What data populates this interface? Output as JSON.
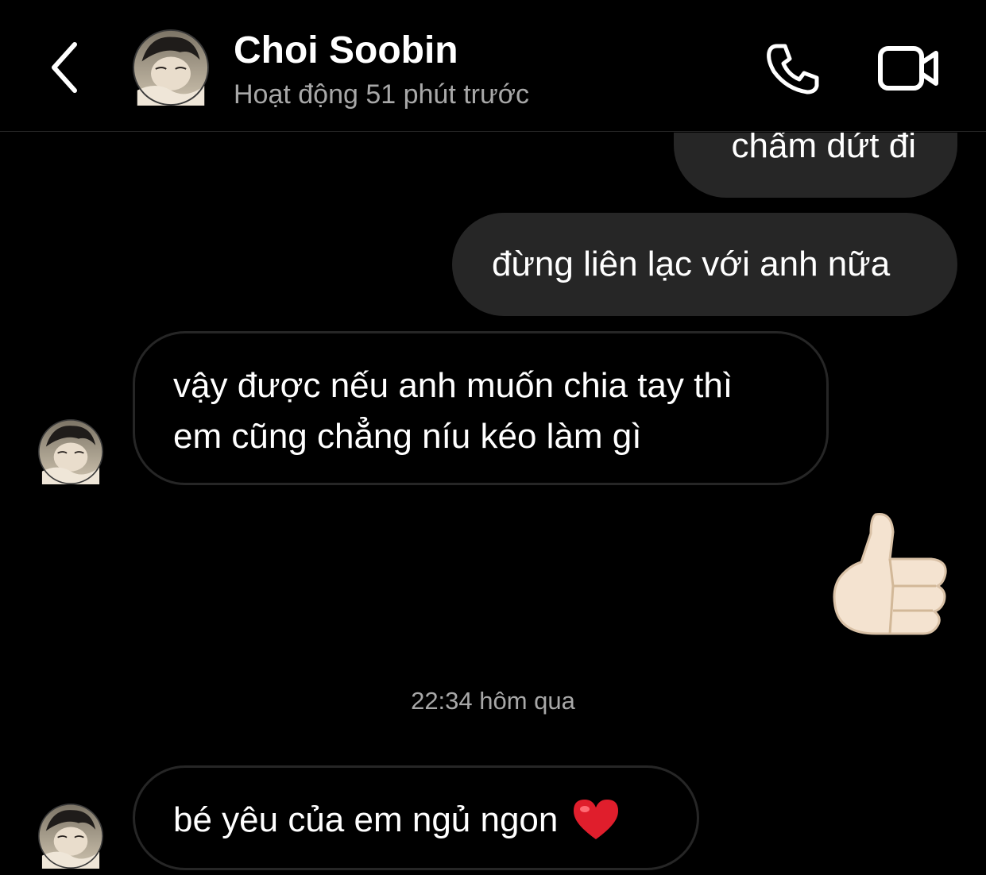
{
  "header": {
    "contact_name": "Choi Soobin",
    "status": "Hoạt động 51 phút trước",
    "icons": [
      "back-chevron-icon",
      "phone-icon",
      "video-camera-icon"
    ]
  },
  "messages": [
    {
      "direction": "outgoing",
      "text": "chấm dứt đi"
    },
    {
      "direction": "outgoing",
      "text": "đừng liên lạc với anh nữa"
    },
    {
      "direction": "incoming",
      "lines": [
        "vậy được nếu anh muốn chia tay thì",
        "em cũng chẳng níu kéo làm gì"
      ]
    },
    {
      "direction": "outgoing",
      "emoji": "thumbs-up"
    },
    {
      "direction": "incoming",
      "text": "bé yêu của em ngủ ngon",
      "emoji": "red-heart"
    }
  ],
  "timestamp": "22:34 hôm qua",
  "colors": {
    "background": "#000000",
    "sent_bubble": "#262626",
    "received_border": "#262626",
    "secondary_text": "#a8a8a8"
  }
}
